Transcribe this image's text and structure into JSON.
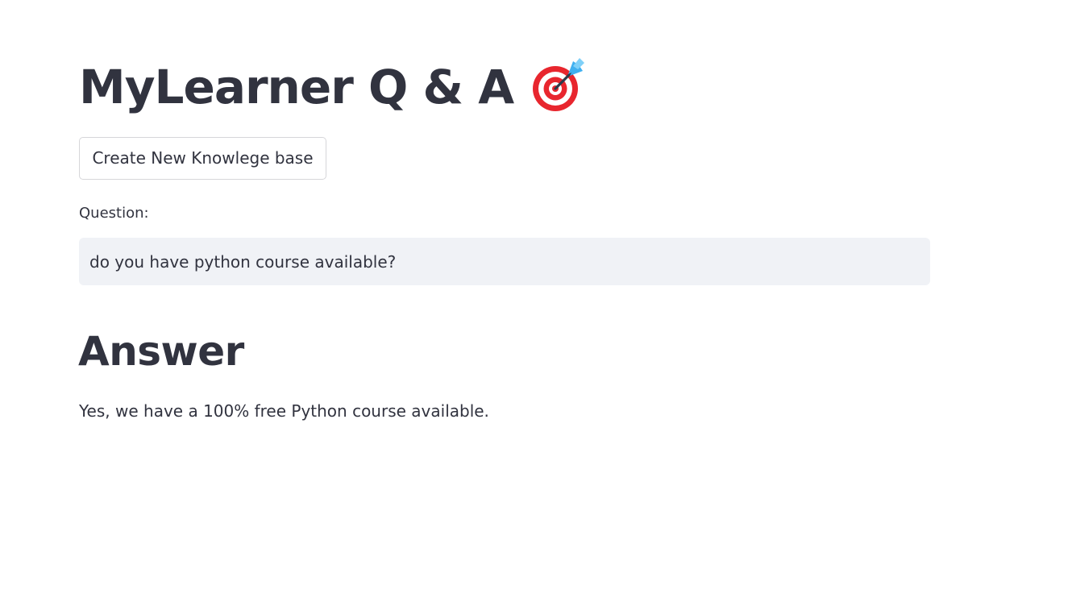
{
  "app": {
    "title": "MyLearner Q & A",
    "title_icon": "direct-hit-target-icon"
  },
  "toolbar": {
    "create_kb_label": "Create New Knowlege base"
  },
  "question": {
    "label": "Question:",
    "value": "do you have python course available?"
  },
  "answer": {
    "heading": "Answer",
    "text": "Yes, we have a 100% free Python course available."
  },
  "colors": {
    "text": "#31333f",
    "input_bg": "#f0f2f6",
    "button_border": "#d6d6d9",
    "target_red": "#e8262e",
    "dart_blue": "#3fb0f0"
  }
}
